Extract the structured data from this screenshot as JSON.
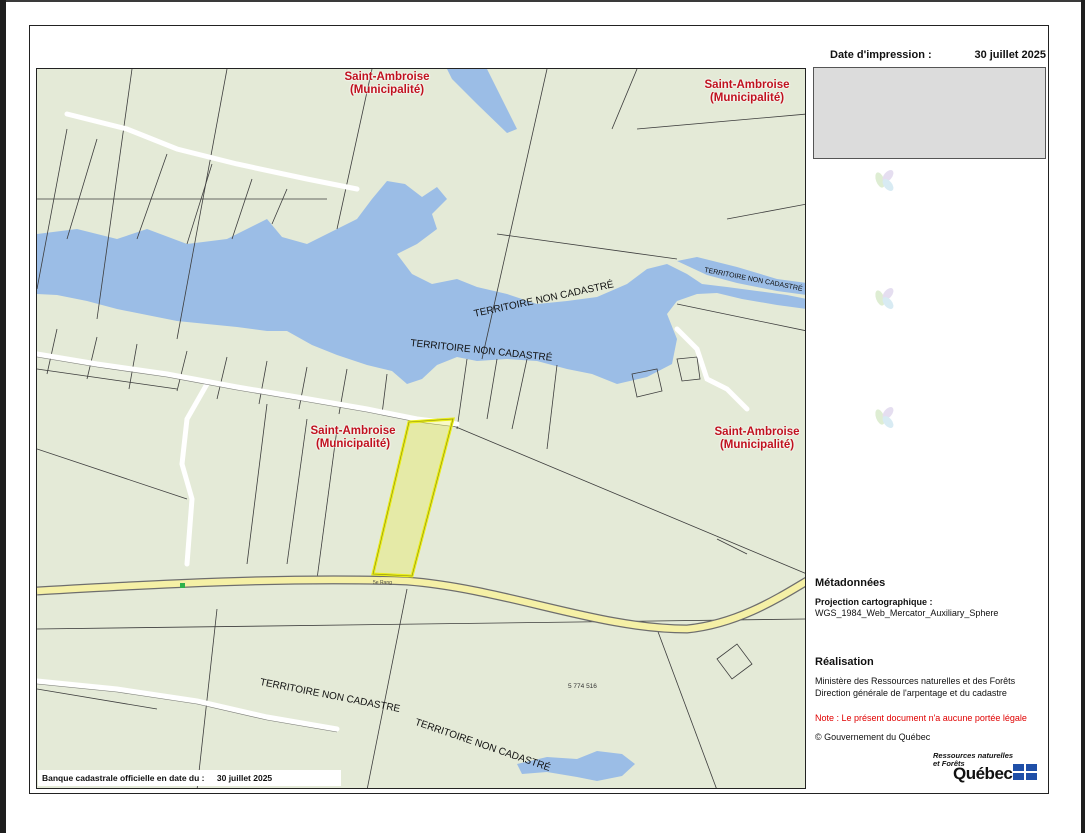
{
  "header": {
    "print_date_label": "Date d'impression :",
    "print_date_value": "30 juillet 2025"
  },
  "map": {
    "municipality_labels": [
      {
        "name": "Saint-Ambroise",
        "type": "(Municipalité)"
      },
      {
        "name": "Saint-Ambroise",
        "type": "(Municipalité)"
      },
      {
        "name": "Saint-Ambroise",
        "type": "(Municipalité)"
      },
      {
        "name": "Saint-Ambroise",
        "type": "(Municipalité)"
      }
    ],
    "territory_labels": [
      "TERRITOIRE NON CADASTRÉ",
      "TERRITOIRE NON CADASTRÉ",
      "TERRITOIRE NON CADASTRÉ",
      "TERRITOIRE NON CADASTRE",
      "TERRITOIRE NON CADASTRÉ"
    ],
    "lot_number": "5 774 516",
    "road_label": "5e Rang",
    "colors": {
      "land": "#e4ead7",
      "water": "#9bbde6",
      "road": "#f5f0a6",
      "selected_lot": "#e9ed18",
      "municipality_label": "#c0121f"
    },
    "bottom_label": {
      "text": "Banque cadastrale officielle en date du :",
      "date": "30 juillet 2025"
    }
  },
  "sidebar": {
    "metadata_heading": "Métadonnées",
    "projection_label": "Projection cartographique :",
    "projection_value": "WGS_1984_Web_Mercator_Auxiliary_Sphere",
    "realisation_heading": "Réalisation",
    "ministry": "Ministère des Ressources naturelles et des Forêts",
    "direction": "Direction générale de l'arpentage et du cadastre",
    "note": "Note : Le présent document n'a aucune portée légale",
    "copyright": "© Gouvernement du Québec",
    "logo_line1": "Ressources naturelles",
    "logo_line2": "et Forêts",
    "logo_brand": "Québec"
  }
}
